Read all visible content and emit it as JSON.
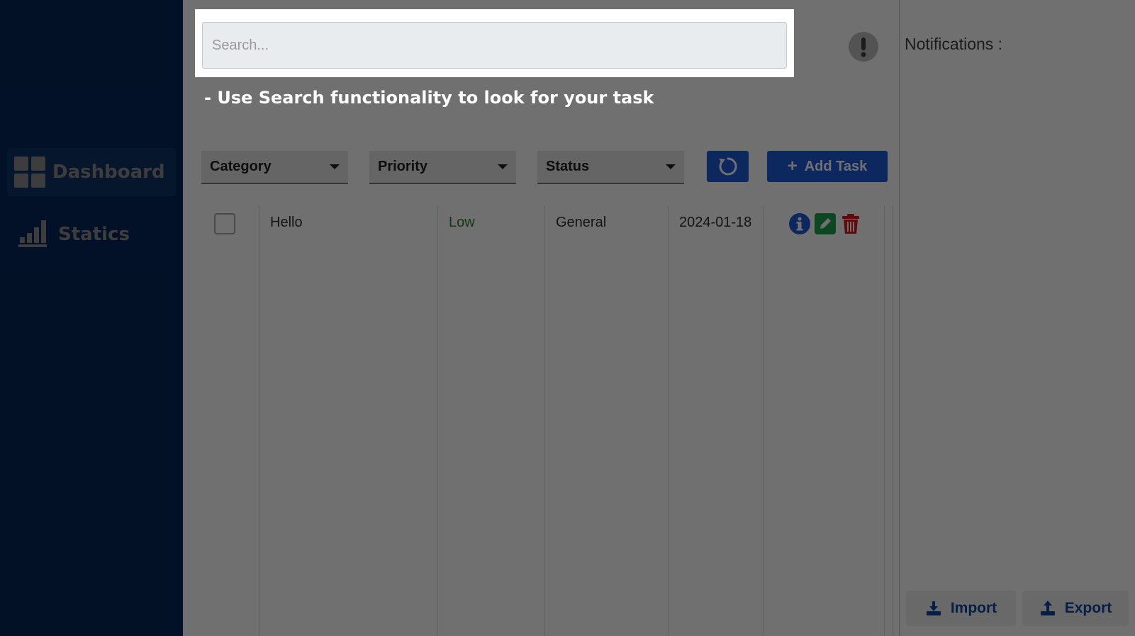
{
  "sidebar": {
    "items": [
      {
        "label": "Dashboard",
        "icon": "dashboard-icon",
        "active": true
      },
      {
        "label": "Statics",
        "icon": "bar-chart-icon",
        "active": false
      }
    ]
  },
  "search": {
    "placeholder": "Search..."
  },
  "tour": {
    "tip": "- Use Search functionality to look for your task"
  },
  "filters": {
    "category": "Category",
    "priority": "Priority",
    "status": "Status"
  },
  "toolbar": {
    "add_task_label": "Add Task",
    "refresh_icon": "refresh-icon"
  },
  "notifications": {
    "title": "Notifications :"
  },
  "tasks": [
    {
      "title": "Hello",
      "priority": "Low",
      "category": "General",
      "date": "2024-01-18"
    }
  ],
  "bottom": {
    "import_label": "Import",
    "export_label": "Export"
  },
  "colors": {
    "sidebar": "#0d47a1",
    "accent": "#1e5bd9",
    "low_priority": "#2e7d32",
    "info": "#1e5bd9",
    "edit": "#1aa34a",
    "delete": "#d81b1b"
  }
}
